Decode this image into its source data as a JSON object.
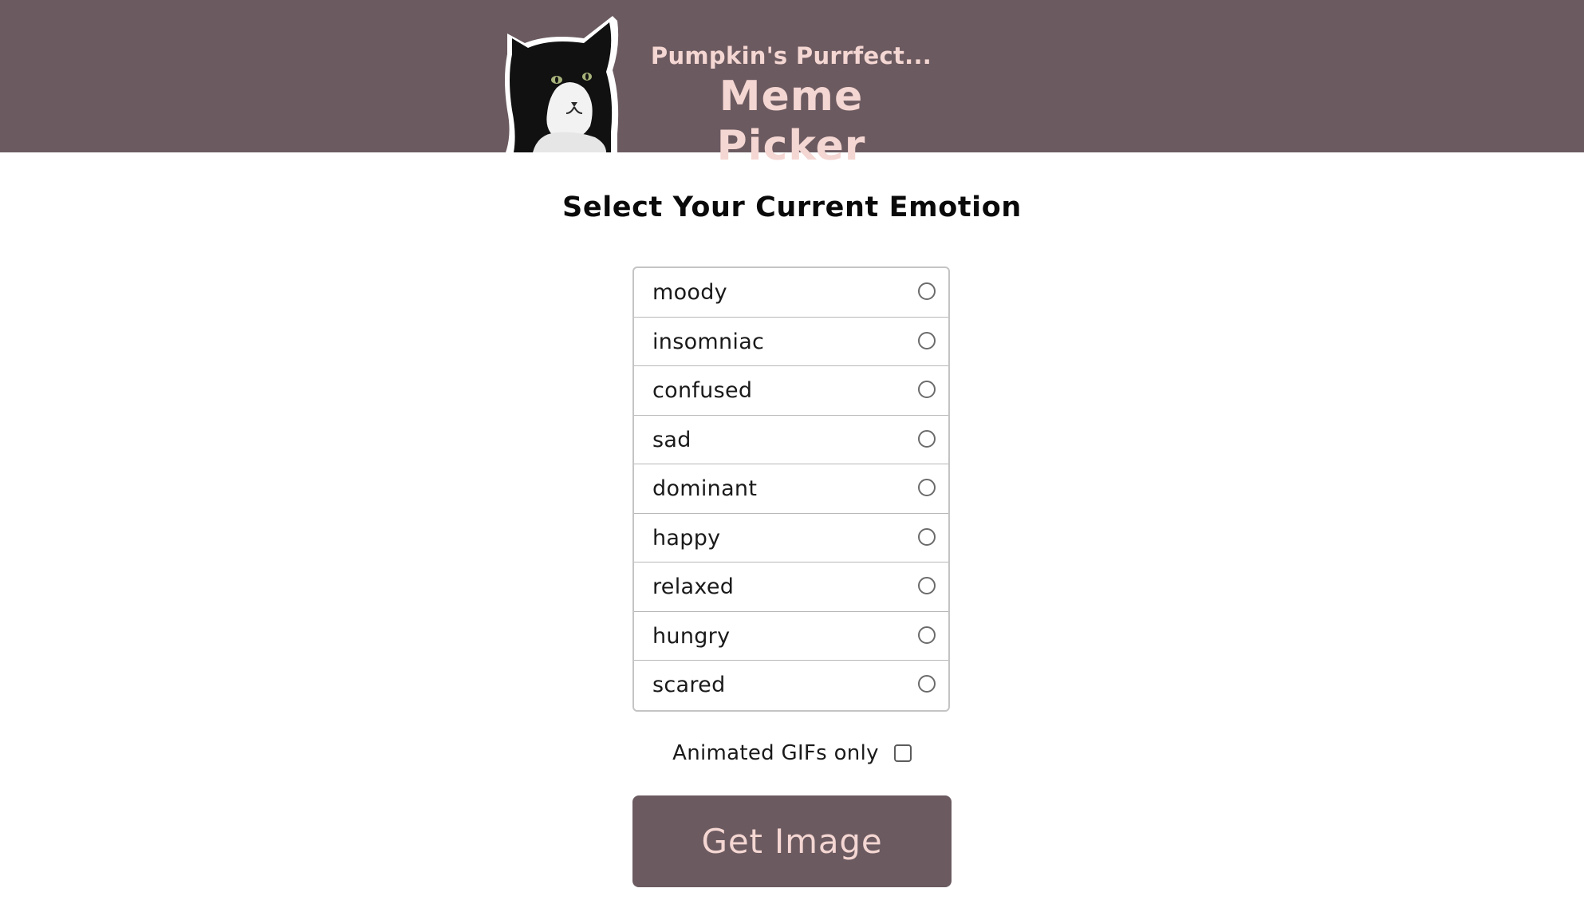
{
  "header": {
    "subtitle": "Pumpkin's Purrfect...",
    "title": "Meme Picker",
    "logo_icon": "cat-photo-logo"
  },
  "main": {
    "heading": "Select Your Current Emotion",
    "emotions": [
      {
        "label": "moody",
        "selected": false
      },
      {
        "label": "insomniac",
        "selected": false
      },
      {
        "label": "confused",
        "selected": false
      },
      {
        "label": "sad",
        "selected": false
      },
      {
        "label": "dominant",
        "selected": false
      },
      {
        "label": "happy",
        "selected": false
      },
      {
        "label": "relaxed",
        "selected": false
      },
      {
        "label": "hungry",
        "selected": false
      },
      {
        "label": "scared",
        "selected": false
      }
    ],
    "gif_only_label": "Animated GIFs only",
    "gif_only_checked": false,
    "get_image_label": "Get Image"
  },
  "colors": {
    "brand": "#6b5a60",
    "brand_text": "#f4d6d2",
    "border": "#c4c4c4"
  }
}
